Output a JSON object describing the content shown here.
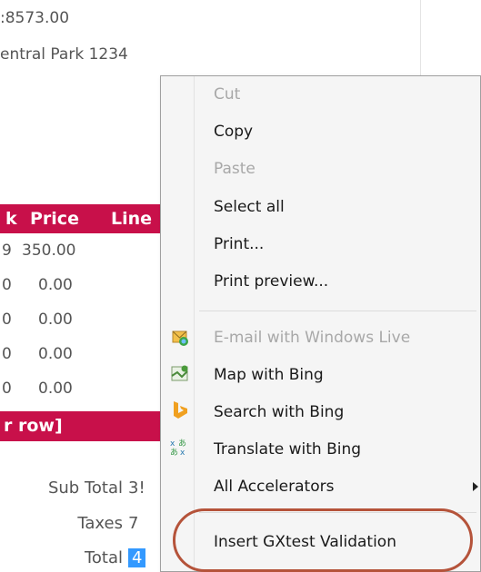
{
  "background": {
    "phone_partial": ":8573.00",
    "address_partial": "entral Park 1234"
  },
  "grid": {
    "header": {
      "col1": "k",
      "col2": "Price",
      "col3": "Line"
    },
    "rows": [
      {
        "c1": "9",
        "c2": "350.00"
      },
      {
        "c1": "0",
        "c2": "0.00"
      },
      {
        "c1": "0",
        "c2": "0.00"
      },
      {
        "c1": "0",
        "c2": "0.00"
      },
      {
        "c1": "0",
        "c2": "0.00"
      }
    ],
    "add_row": "r row]"
  },
  "totals": {
    "sub_total_label": "Sub Total",
    "sub_total_value": "3!",
    "taxes_label": "Taxes",
    "taxes_value": "7",
    "total_label": "Total",
    "total_value": "4"
  },
  "context_menu": {
    "items": [
      {
        "label": "Cut",
        "enabled": false
      },
      {
        "label": "Copy",
        "enabled": true
      },
      {
        "label": "Paste",
        "enabled": false
      },
      {
        "label": "Select all",
        "enabled": true
      },
      {
        "label": "Print...",
        "enabled": true
      },
      {
        "label": "Print preview...",
        "enabled": true
      },
      {
        "label": "E-mail with Windows Live",
        "enabled": false,
        "icon": "windows-live-mail-icon"
      },
      {
        "label": "Map with Bing",
        "enabled": true,
        "icon": "bing-map-icon"
      },
      {
        "label": "Search with Bing",
        "enabled": true,
        "icon": "bing-search-icon"
      },
      {
        "label": "Translate with Bing",
        "enabled": true,
        "icon": "translate-icon"
      },
      {
        "label": "All Accelerators",
        "enabled": true,
        "submenu": true
      },
      {
        "label": "Insert GXtest Validation",
        "enabled": true
      }
    ]
  },
  "colors": {
    "grid_header": "#c8104a",
    "selection": "#3399ff",
    "annotation_oval": "#b5533a"
  }
}
